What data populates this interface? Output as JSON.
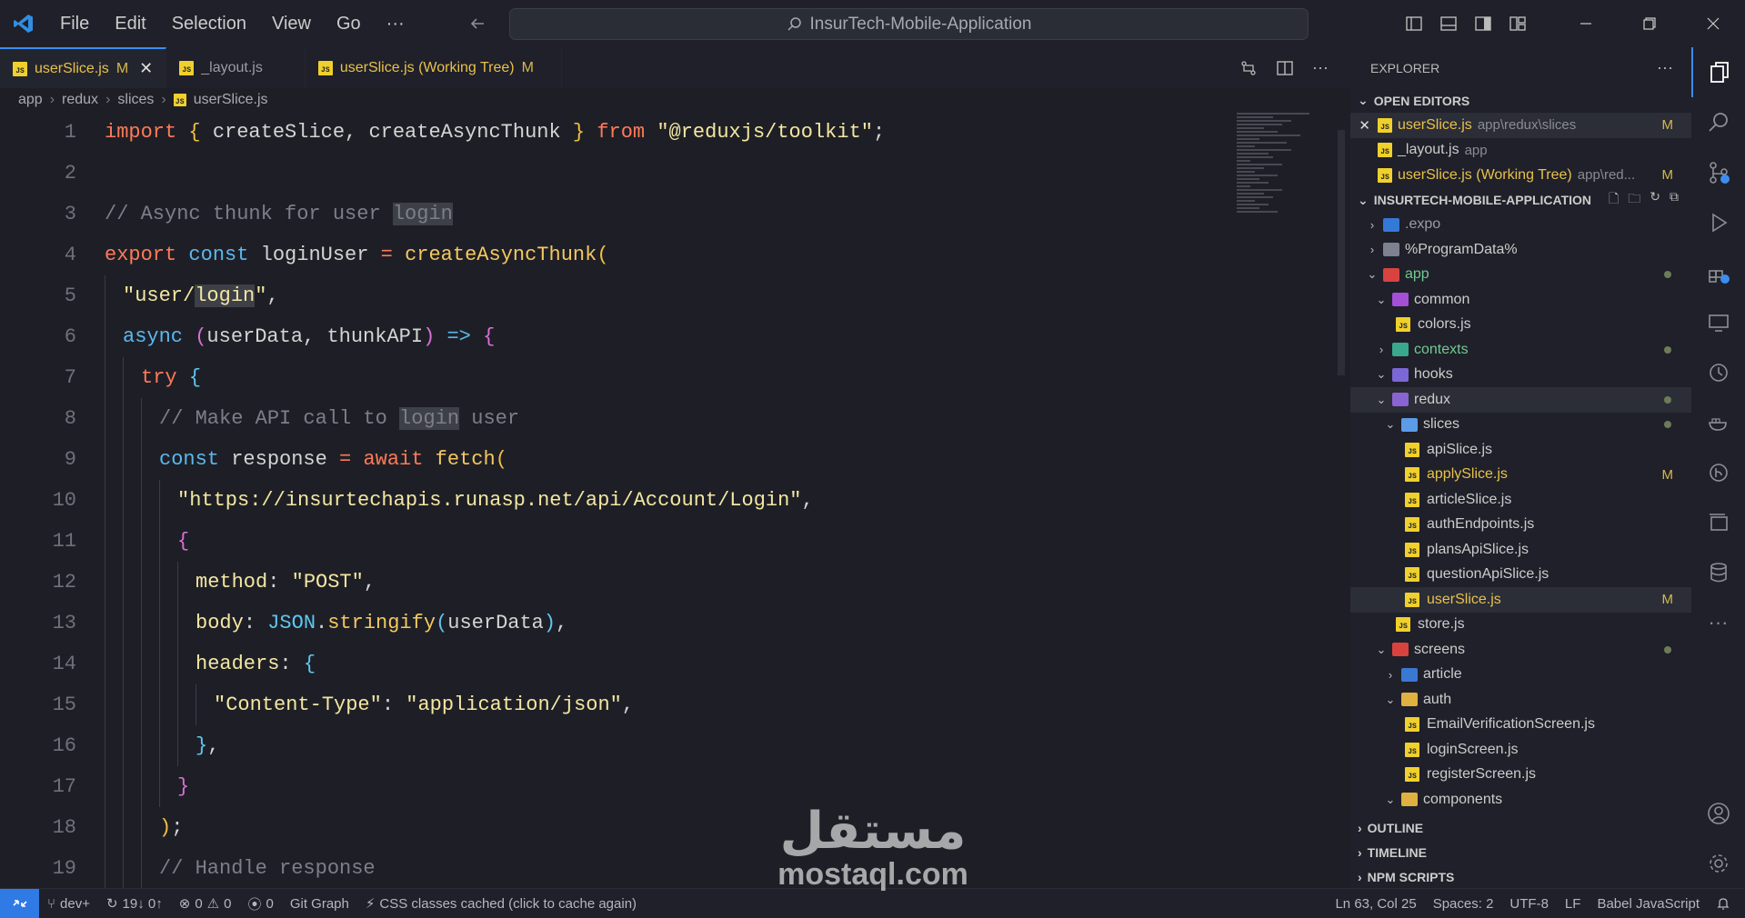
{
  "titlebar": {
    "menu": [
      "File",
      "Edit",
      "Selection",
      "View",
      "Go",
      "···"
    ],
    "search_text": "InsurTech-Mobile-Application"
  },
  "tabs": [
    {
      "label": "userSlice.js",
      "badge": "M",
      "active": true
    },
    {
      "label": "_layout.js",
      "badge": "",
      "active": false
    },
    {
      "label": "userSlice.js (Working Tree)",
      "badge": "M",
      "active": false
    }
  ],
  "breadcrumbs": [
    "app",
    "redux",
    "slices",
    "userSlice.js"
  ],
  "editor": {
    "line_numbers": [
      "1",
      "2",
      "3",
      "4",
      "5",
      "6",
      "7",
      "8",
      "9",
      "10",
      "11",
      "12",
      "13",
      "14",
      "15",
      "16",
      "17",
      "18",
      "19"
    ]
  },
  "explorer": {
    "title": "EXPLORER",
    "open_editors_title": "OPEN EDITORS",
    "open_editors": [
      {
        "name": "userSlice.js",
        "desc": "app\\redux\\slices",
        "badge": "M"
      },
      {
        "name": "_layout.js",
        "desc": "app",
        "badge": ""
      },
      {
        "name": "userSlice.js (Working Tree)",
        "desc": "app\\red...",
        "badge": "M"
      }
    ],
    "project_title": "INSURTECH-MOBILE-APPLICATION",
    "tree": [
      {
        "name": ".expo"
      },
      {
        "name": "%ProgramData%"
      },
      {
        "name": "app"
      },
      {
        "name": "common"
      },
      {
        "name": "colors.js"
      },
      {
        "name": "contexts"
      },
      {
        "name": "hooks"
      },
      {
        "name": "redux"
      },
      {
        "name": "slices"
      },
      {
        "name": "apiSlice.js"
      },
      {
        "name": "applySlice.js",
        "badge": "M"
      },
      {
        "name": "articleSlice.js"
      },
      {
        "name": "authEndpoints.js"
      },
      {
        "name": "plansApiSlice.js"
      },
      {
        "name": "questionApiSlice.js"
      },
      {
        "name": "userSlice.js",
        "badge": "M"
      },
      {
        "name": "store.js"
      },
      {
        "name": "screens"
      },
      {
        "name": "article"
      },
      {
        "name": "auth"
      },
      {
        "name": "EmailVerificationScreen.js"
      },
      {
        "name": "loginScreen.js"
      },
      {
        "name": "registerScreen.js"
      },
      {
        "name": "components"
      }
    ],
    "sections": [
      "OUTLINE",
      "TIMELINE",
      "NPM SCRIPTS"
    ]
  },
  "statusbar": {
    "branch": "dev+",
    "sync": "19↓ 0↑",
    "errors": "0",
    "warnings": "0",
    "ports": "0",
    "git_graph": "Git Graph",
    "css": "CSS classes cached (click to cache again)",
    "position": "Ln 63, Col 25",
    "spaces": "Spaces: 2",
    "encoding": "UTF-8",
    "eol": "LF",
    "language": "Babel JavaScript"
  },
  "watermark": {
    "ar": "مستقل",
    "en": "mostaql.com"
  },
  "colors": {
    "accent": "#3c8df0",
    "modified": "#e8c14a",
    "background": "#1e1f26"
  }
}
